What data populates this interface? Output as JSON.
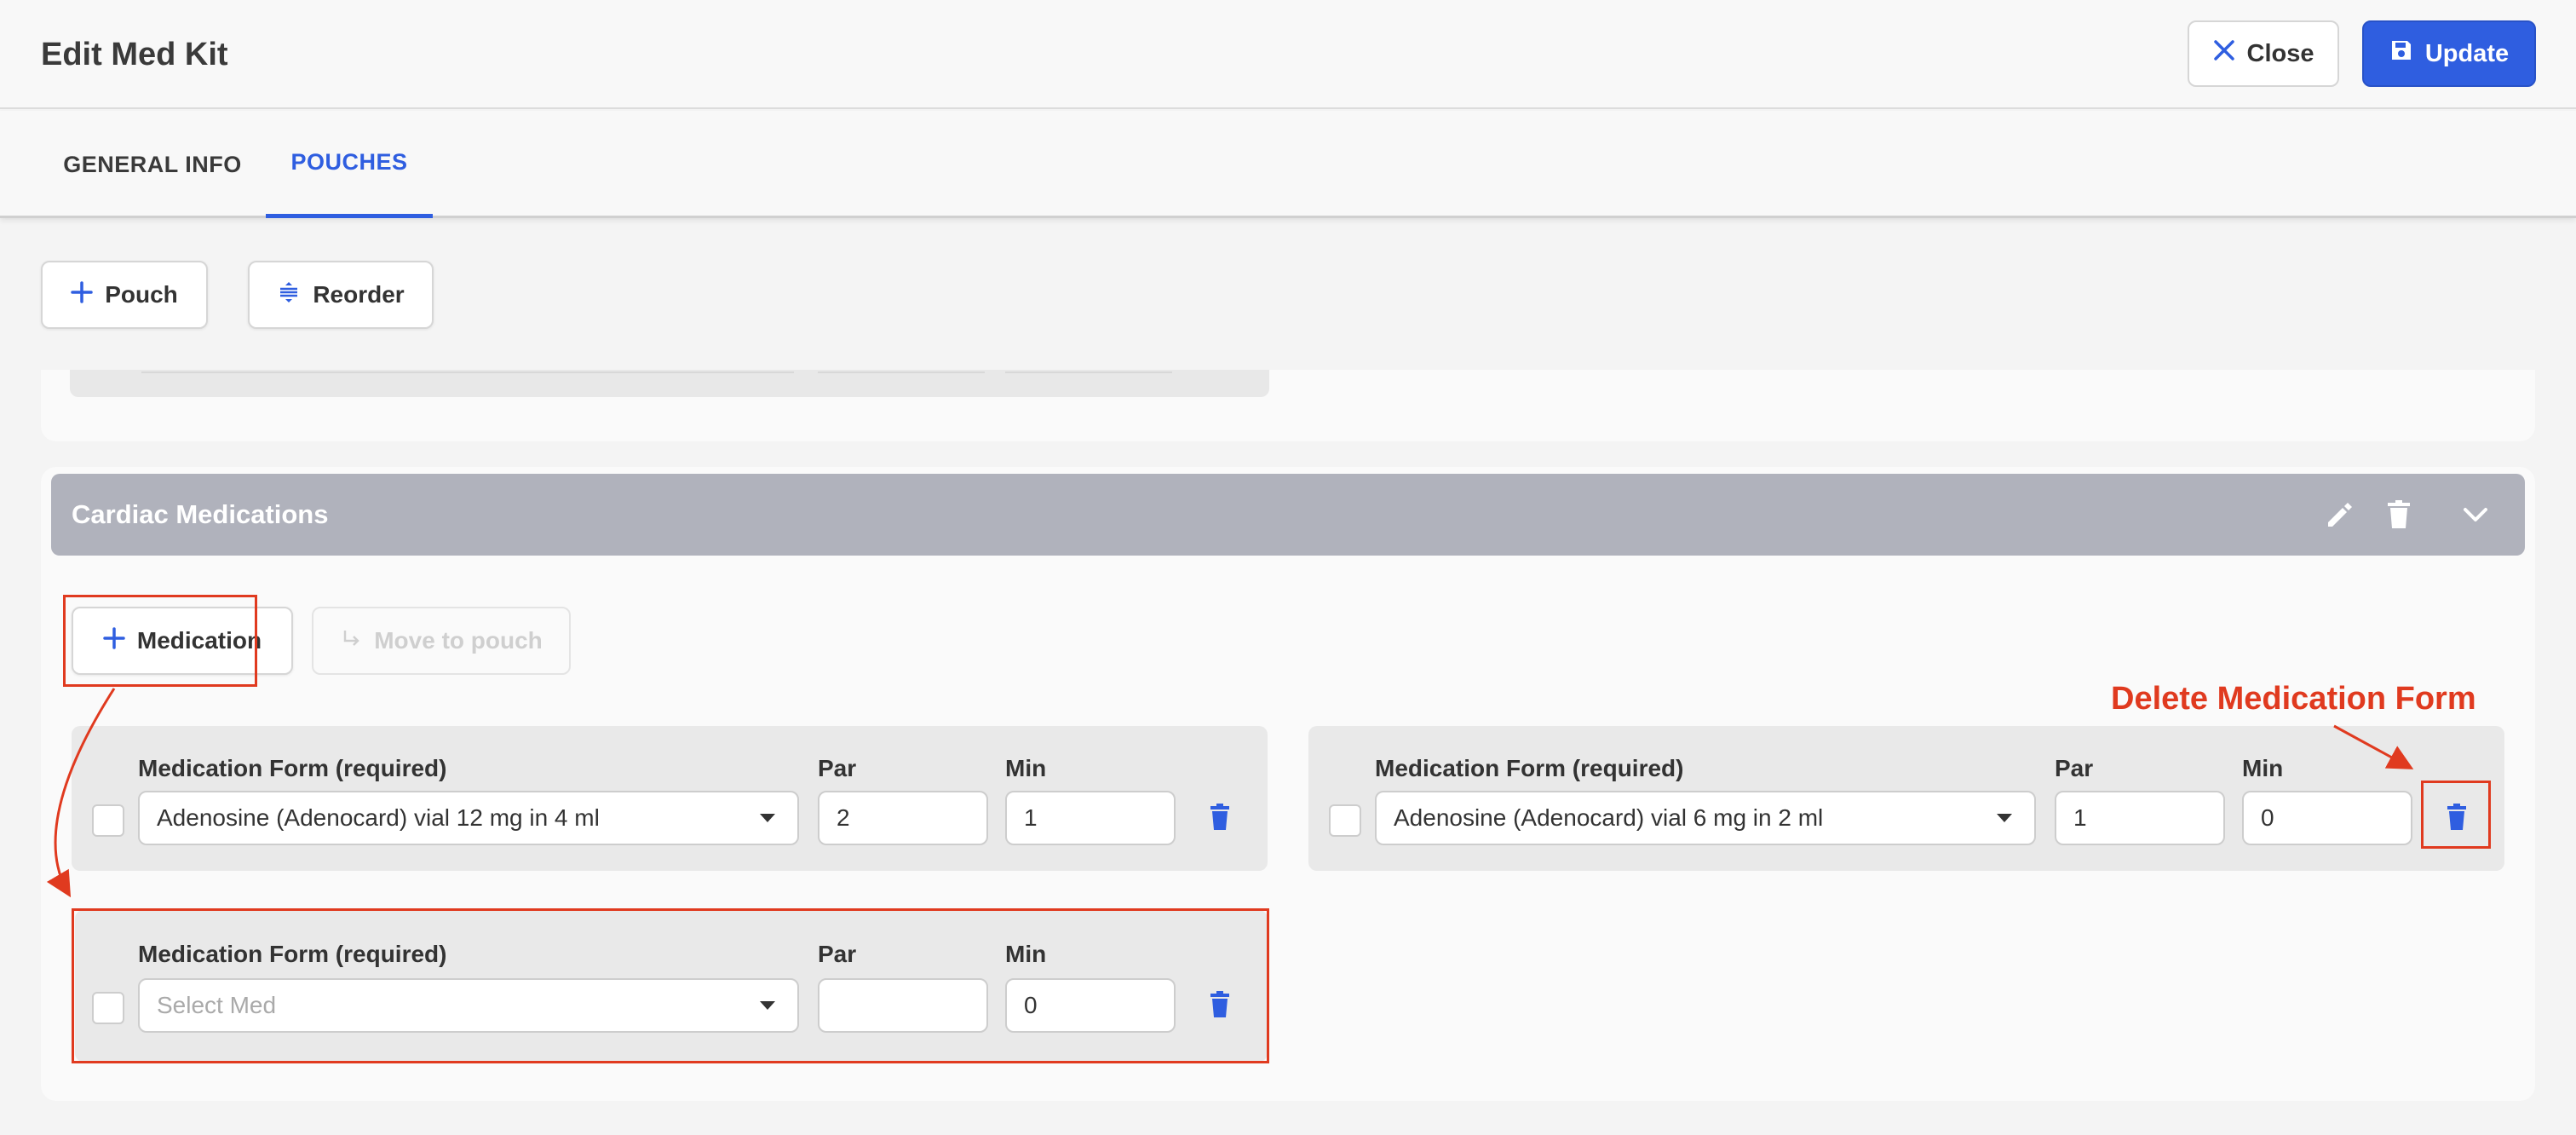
{
  "header": {
    "title": "Edit Med Kit",
    "close_label": "Close",
    "update_label": "Update"
  },
  "tabs": [
    {
      "label": "GENERAL INFO",
      "active": false
    },
    {
      "label": "POUCHES",
      "active": true
    }
  ],
  "toolbar": {
    "pouch_label": "Pouch",
    "reorder_label": "Reorder"
  },
  "pouch": {
    "name": "Cardiac Medications",
    "add_medication_label": "Medication",
    "move_to_pouch_label": "Move to pouch",
    "forms": [
      {
        "form_label": "Medication Form (required)",
        "par_label": "Par",
        "min_label": "Min",
        "medication": "Adenosine (Adenocard) vial 12 mg in 4 ml",
        "par": "2",
        "min": "1",
        "checked": false
      },
      {
        "form_label": "Medication Form (required)",
        "par_label": "Par",
        "min_label": "Min",
        "medication": "Adenosine (Adenocard) vial 6 mg in 2 ml",
        "par": "1",
        "min": "0",
        "checked": false
      },
      {
        "form_label": "Medication Form (required)",
        "par_label": "Par",
        "min_label": "Min",
        "medication": "",
        "medication_placeholder": "Select Med",
        "par": "",
        "min": "0",
        "checked": false
      }
    ]
  },
  "annotation": {
    "label": "Delete Medication Form"
  },
  "colors": {
    "accent": "#2f5ee0",
    "annotation": "#e03a1f",
    "pouch_header": "#b0b2bc"
  },
  "icons": [
    "close-icon",
    "save-icon",
    "plus-icon",
    "reorder-icon",
    "pencil-icon",
    "trash-icon",
    "chevron-down-icon",
    "move-arrow-icon",
    "caret-down-icon"
  ]
}
